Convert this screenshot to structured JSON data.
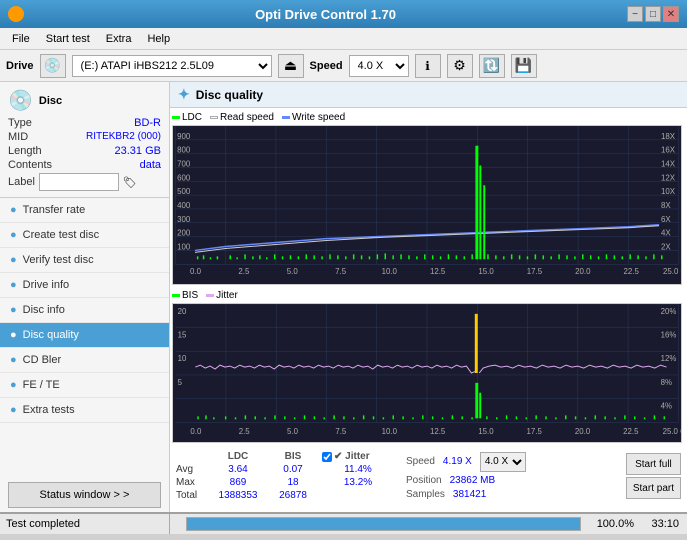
{
  "titlebar": {
    "title": "Opti Drive Control 1.70",
    "min_label": "−",
    "max_label": "□",
    "close_label": "✕"
  },
  "menubar": {
    "items": [
      "File",
      "Start test",
      "Extra",
      "Help"
    ]
  },
  "toolbar": {
    "drive_label": "Drive",
    "drive_value": "(E:) ATAPI iHBS212  2.5L09",
    "speed_label": "Speed",
    "speed_value": "4.0 X"
  },
  "disc_info": {
    "title": "Disc",
    "type_label": "Type",
    "type_value": "BD-R",
    "mid_label": "MID",
    "mid_value": "RITEKBR2 (000)",
    "length_label": "Length",
    "length_value": "23.31 GB",
    "contents_label": "Contents",
    "contents_value": "data",
    "label_label": "Label",
    "label_value": ""
  },
  "nav": {
    "items": [
      {
        "id": "transfer-rate",
        "label": "Transfer rate"
      },
      {
        "id": "create-test-disc",
        "label": "Create test disc"
      },
      {
        "id": "verify-test-disc",
        "label": "Verify test disc"
      },
      {
        "id": "drive-info",
        "label": "Drive info"
      },
      {
        "id": "disc-info",
        "label": "Disc info"
      },
      {
        "id": "disc-quality",
        "label": "Disc quality",
        "active": true
      },
      {
        "id": "cd-bler",
        "label": "CD Bler"
      },
      {
        "id": "fe-te",
        "label": "FE / TE"
      },
      {
        "id": "extra-tests",
        "label": "Extra tests"
      }
    ],
    "status_btn": "Status window > >"
  },
  "chart": {
    "title": "Disc quality",
    "legend": [
      {
        "id": "ldc",
        "label": "LDC",
        "color": "#00ff00"
      },
      {
        "id": "read-speed",
        "label": "Read speed",
        "color": "#ffffff"
      },
      {
        "id": "write-speed",
        "label": "Write speed",
        "color": "#4488ff"
      }
    ],
    "legend2": [
      {
        "id": "bis",
        "label": "BIS",
        "color": "#00ff00"
      },
      {
        "id": "jitter",
        "label": "Jitter",
        "color": "#ffaaff"
      }
    ]
  },
  "stats": {
    "ldc_label": "LDC",
    "bis_label": "BIS",
    "jitter_label": "✔ Jitter",
    "speed_label": "Speed",
    "speed_value": "4.19 X",
    "position_label": "Position",
    "position_value": "23862 MB",
    "samples_label": "Samples",
    "samples_value": "381421",
    "speed_select": "4.0 X",
    "rows": [
      {
        "id": "avg",
        "label": "Avg",
        "ldc": "3.64",
        "bis": "0.07",
        "jitter": "11.4%"
      },
      {
        "id": "max",
        "label": "Max",
        "ldc": "869",
        "bis": "18",
        "jitter": "13.2%"
      },
      {
        "id": "total",
        "label": "Total",
        "ldc": "1388353",
        "bis": "26878",
        "jitter": ""
      }
    ],
    "start_full_label": "Start full",
    "start_part_label": "Start part"
  },
  "statusbar": {
    "status_window_label": "Status window > >",
    "test_completed_label": "Test completed",
    "progress_pct": "100.0%",
    "time_value": "33:10"
  },
  "colors": {
    "accent": "#4a9fd4",
    "active_nav": "#4a9fd4",
    "chart_bg": "#1a1a2e",
    "grid_line": "#2a3a5a",
    "ldc_color": "#00ff00",
    "read_speed_color": "#ffffff",
    "write_speed_color": "#6688ff",
    "bis_color": "#00ff00",
    "jitter_color": "#ddaaee",
    "yellow_spike": "#ffcc00",
    "axis_label": "#aaaaaa"
  }
}
